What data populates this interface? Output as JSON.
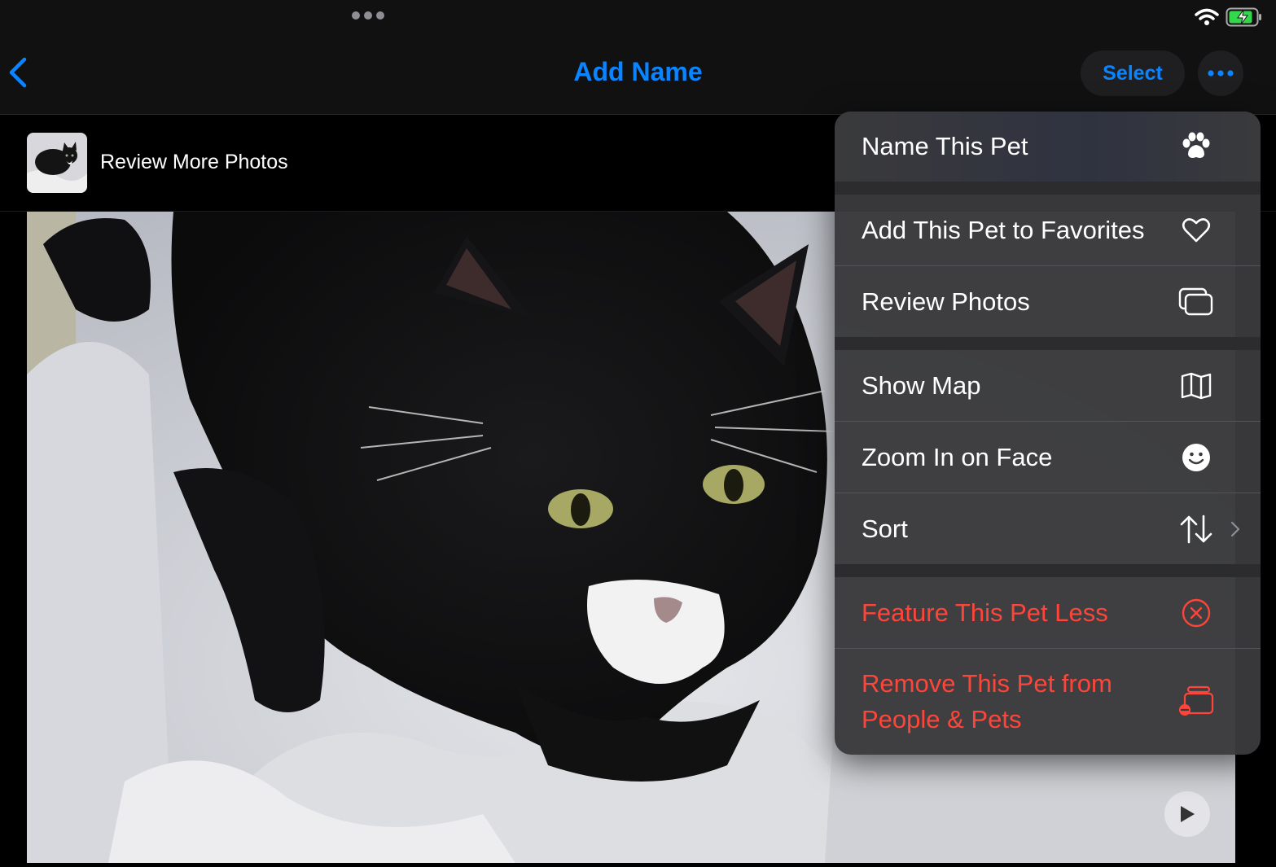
{
  "status": {
    "wifi_icon": "wifi-icon",
    "battery_icon": "battery-charging-icon"
  },
  "nav": {
    "title": "Add Name",
    "select_label": "Select",
    "back_icon": "chevron-left-icon",
    "more_icon": "ellipsis-icon",
    "accent": "#0a84ff"
  },
  "review": {
    "label": "Review More Photos"
  },
  "menu": {
    "items": [
      {
        "label": "Name This Pet",
        "icon": "paw-icon"
      },
      {
        "label": "Add This Pet to Favorites",
        "icon": "heart-icon"
      },
      {
        "label": "Review Photos",
        "icon": "photos-stack-icon"
      },
      {
        "label": "Show Map",
        "icon": "map-icon"
      },
      {
        "label": "Zoom In on Face",
        "icon": "smiley-face-icon"
      },
      {
        "label": "Sort",
        "icon": "sort-arrows-icon",
        "submenu_icon": "chevron-right-icon"
      },
      {
        "label": "Feature This Pet Less",
        "icon": "x-circle-icon",
        "destructive": true
      },
      {
        "label": "Remove This Pet from People & Pets",
        "icon": "remove-person-icon",
        "destructive": true
      }
    ],
    "destructive_color": "#ff453a"
  },
  "photo": {
    "play_icon": "play-icon"
  }
}
